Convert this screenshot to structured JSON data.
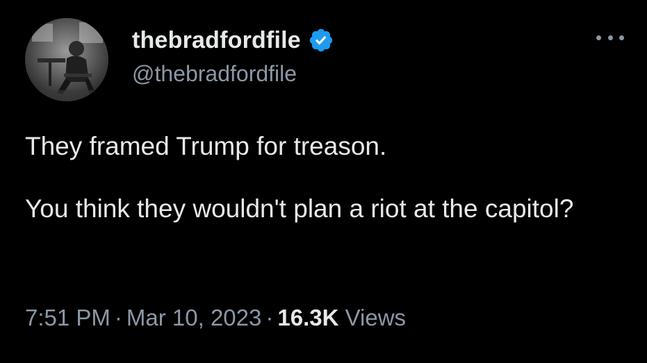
{
  "author": {
    "display_name": "thebradfordfile",
    "handle": "@thebradfordfile",
    "verified": true,
    "avatar_icon": "profile-photo",
    "verified_icon": "verified-badge-icon",
    "verified_color": "#1d9bf0"
  },
  "tweet": {
    "paragraph_1": "They framed Trump for treason.",
    "paragraph_2": "You think they wouldn't plan a riot at the capitol?"
  },
  "meta": {
    "time": "7:51 PM",
    "separator": "·",
    "date": "Mar 10, 2023",
    "views_count": "16.3K",
    "views_label": "Views"
  },
  "menu": {
    "more_icon": "more-options-icon"
  },
  "colors": {
    "background": "#000000",
    "primary_text": "#e7e9ea",
    "secondary_text": "#8b98a5"
  }
}
